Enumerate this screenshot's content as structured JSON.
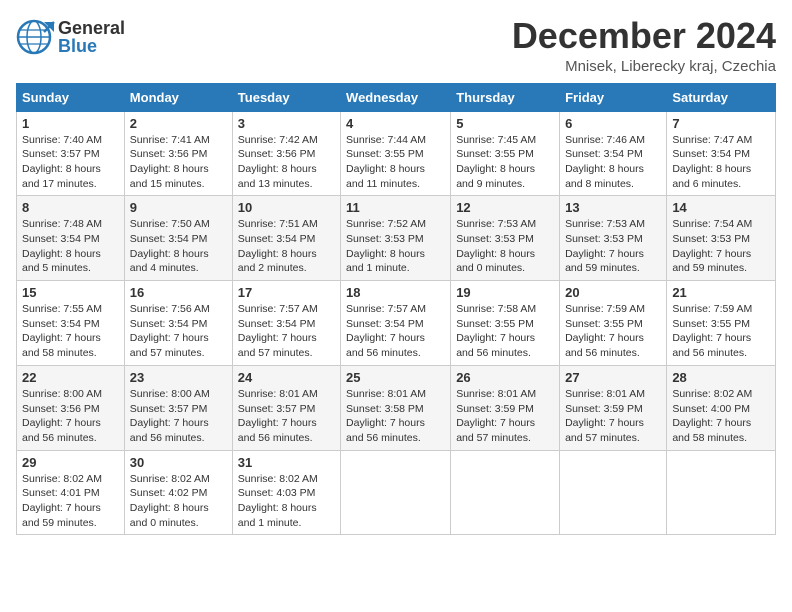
{
  "header": {
    "logo_general": "General",
    "logo_blue": "Blue",
    "month_title": "December 2024",
    "location": "Mnisek, Liberecky kraj, Czechia"
  },
  "days_of_week": [
    "Sunday",
    "Monday",
    "Tuesday",
    "Wednesday",
    "Thursday",
    "Friday",
    "Saturday"
  ],
  "weeks": [
    [
      {
        "day": "1",
        "sunrise": "7:40 AM",
        "sunset": "3:57 PM",
        "daylight": "8 hours and 17 minutes."
      },
      {
        "day": "2",
        "sunrise": "7:41 AM",
        "sunset": "3:56 PM",
        "daylight": "8 hours and 15 minutes."
      },
      {
        "day": "3",
        "sunrise": "7:42 AM",
        "sunset": "3:56 PM",
        "daylight": "8 hours and 13 minutes."
      },
      {
        "day": "4",
        "sunrise": "7:44 AM",
        "sunset": "3:55 PM",
        "daylight": "8 hours and 11 minutes."
      },
      {
        "day": "5",
        "sunrise": "7:45 AM",
        "sunset": "3:55 PM",
        "daylight": "8 hours and 9 minutes."
      },
      {
        "day": "6",
        "sunrise": "7:46 AM",
        "sunset": "3:54 PM",
        "daylight": "8 hours and 8 minutes."
      },
      {
        "day": "7",
        "sunrise": "7:47 AM",
        "sunset": "3:54 PM",
        "daylight": "8 hours and 6 minutes."
      }
    ],
    [
      {
        "day": "8",
        "sunrise": "7:48 AM",
        "sunset": "3:54 PM",
        "daylight": "8 hours and 5 minutes."
      },
      {
        "day": "9",
        "sunrise": "7:50 AM",
        "sunset": "3:54 PM",
        "daylight": "8 hours and 4 minutes."
      },
      {
        "day": "10",
        "sunrise": "7:51 AM",
        "sunset": "3:54 PM",
        "daylight": "8 hours and 2 minutes."
      },
      {
        "day": "11",
        "sunrise": "7:52 AM",
        "sunset": "3:53 PM",
        "daylight": "8 hours and 1 minute."
      },
      {
        "day": "12",
        "sunrise": "7:53 AM",
        "sunset": "3:53 PM",
        "daylight": "8 hours and 0 minutes."
      },
      {
        "day": "13",
        "sunrise": "7:53 AM",
        "sunset": "3:53 PM",
        "daylight": "7 hours and 59 minutes."
      },
      {
        "day": "14",
        "sunrise": "7:54 AM",
        "sunset": "3:53 PM",
        "daylight": "7 hours and 59 minutes."
      }
    ],
    [
      {
        "day": "15",
        "sunrise": "7:55 AM",
        "sunset": "3:54 PM",
        "daylight": "7 hours and 58 minutes."
      },
      {
        "day": "16",
        "sunrise": "7:56 AM",
        "sunset": "3:54 PM",
        "daylight": "7 hours and 57 minutes."
      },
      {
        "day": "17",
        "sunrise": "7:57 AM",
        "sunset": "3:54 PM",
        "daylight": "7 hours and 57 minutes."
      },
      {
        "day": "18",
        "sunrise": "7:57 AM",
        "sunset": "3:54 PM",
        "daylight": "7 hours and 56 minutes."
      },
      {
        "day": "19",
        "sunrise": "7:58 AM",
        "sunset": "3:55 PM",
        "daylight": "7 hours and 56 minutes."
      },
      {
        "day": "20",
        "sunrise": "7:59 AM",
        "sunset": "3:55 PM",
        "daylight": "7 hours and 56 minutes."
      },
      {
        "day": "21",
        "sunrise": "7:59 AM",
        "sunset": "3:55 PM",
        "daylight": "7 hours and 56 minutes."
      }
    ],
    [
      {
        "day": "22",
        "sunrise": "8:00 AM",
        "sunset": "3:56 PM",
        "daylight": "7 hours and 56 minutes."
      },
      {
        "day": "23",
        "sunrise": "8:00 AM",
        "sunset": "3:57 PM",
        "daylight": "7 hours and 56 minutes."
      },
      {
        "day": "24",
        "sunrise": "8:01 AM",
        "sunset": "3:57 PM",
        "daylight": "7 hours and 56 minutes."
      },
      {
        "day": "25",
        "sunrise": "8:01 AM",
        "sunset": "3:58 PM",
        "daylight": "7 hours and 56 minutes."
      },
      {
        "day": "26",
        "sunrise": "8:01 AM",
        "sunset": "3:59 PM",
        "daylight": "7 hours and 57 minutes."
      },
      {
        "day": "27",
        "sunrise": "8:01 AM",
        "sunset": "3:59 PM",
        "daylight": "7 hours and 57 minutes."
      },
      {
        "day": "28",
        "sunrise": "8:02 AM",
        "sunset": "4:00 PM",
        "daylight": "7 hours and 58 minutes."
      }
    ],
    [
      {
        "day": "29",
        "sunrise": "8:02 AM",
        "sunset": "4:01 PM",
        "daylight": "7 hours and 59 minutes."
      },
      {
        "day": "30",
        "sunrise": "8:02 AM",
        "sunset": "4:02 PM",
        "daylight": "8 hours and 0 minutes."
      },
      {
        "day": "31",
        "sunrise": "8:02 AM",
        "sunset": "4:03 PM",
        "daylight": "8 hours and 1 minute."
      },
      null,
      null,
      null,
      null
    ]
  ]
}
